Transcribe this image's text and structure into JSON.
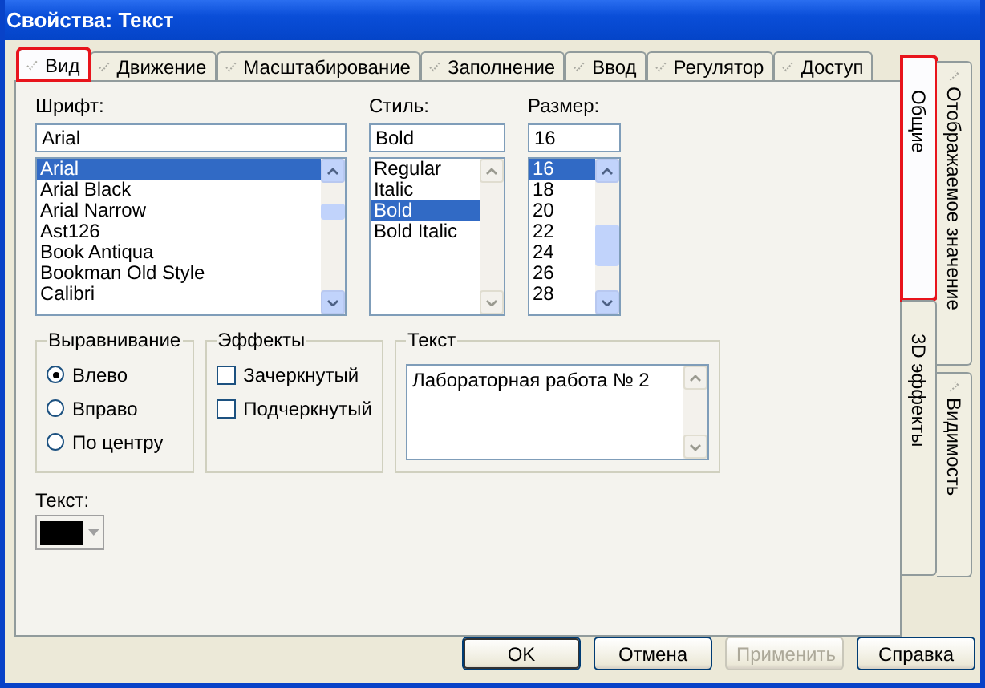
{
  "window": {
    "title": "Свойства: Текст"
  },
  "tabs": [
    {
      "label": "Вид",
      "selected": true,
      "marked": true
    },
    {
      "label": "Движение",
      "selected": false,
      "marked": false
    },
    {
      "label": "Масштабирование",
      "selected": false,
      "marked": false
    },
    {
      "label": "Заполнение",
      "selected": false,
      "marked": false
    },
    {
      "label": "Ввод",
      "selected": false,
      "marked": false
    },
    {
      "label": "Регулятор",
      "selected": false,
      "marked": false
    },
    {
      "label": "Доступ",
      "selected": false,
      "marked": false
    }
  ],
  "font": {
    "label": "Шрифт:",
    "value": "Arial",
    "items": [
      {
        "text": "Arial",
        "selected": true
      },
      {
        "text": "Arial Black",
        "selected": false
      },
      {
        "text": "Arial Narrow",
        "selected": false
      },
      {
        "text": "Ast126",
        "selected": false
      },
      {
        "text": "Book Antiqua",
        "selected": false
      },
      {
        "text": "Bookman Old Style",
        "selected": false
      },
      {
        "text": "Calibri",
        "selected": false
      }
    ]
  },
  "style": {
    "label": "Стиль:",
    "value": "Bold",
    "items": [
      {
        "text": "Regular",
        "selected": false
      },
      {
        "text": "Italic",
        "selected": false
      },
      {
        "text": "Bold",
        "selected": true
      },
      {
        "text": "Bold Italic",
        "selected": false
      }
    ]
  },
  "size": {
    "label": "Размер:",
    "value": "16",
    "items": [
      {
        "text": "16",
        "selected": true
      },
      {
        "text": "18",
        "selected": false
      },
      {
        "text": "20",
        "selected": false
      },
      {
        "text": "22",
        "selected": false
      },
      {
        "text": "24",
        "selected": false
      },
      {
        "text": "26",
        "selected": false
      },
      {
        "text": "28",
        "selected": false
      }
    ]
  },
  "alignment": {
    "title": "Выравнивание",
    "options": [
      {
        "label": "Влево",
        "selected": true
      },
      {
        "label": "Вправо",
        "selected": false
      },
      {
        "label": "По центру",
        "selected": false
      }
    ]
  },
  "effects": {
    "title": "Эффекты",
    "options": [
      {
        "label": "Зачеркнутый",
        "checked": false
      },
      {
        "label": "Подчеркнутый",
        "checked": false
      }
    ]
  },
  "text_group": {
    "title": "Текст",
    "value": "Лабораторная работа № 2"
  },
  "text_color": {
    "label": "Текст:",
    "color": "#000000"
  },
  "side_tabs": [
    [
      {
        "label": "Общие",
        "selected": true,
        "marked": true,
        "checkmark": false
      },
      {
        "label": "3D эффекты",
        "selected": false,
        "marked": false,
        "checkmark": false
      }
    ],
    [
      {
        "label": "Отображаемое значение",
        "selected": false,
        "marked": false,
        "checkmark": true
      },
      {
        "label": "Видимость",
        "selected": false,
        "marked": false,
        "checkmark": true
      }
    ]
  ],
  "buttons": [
    {
      "label": "OK",
      "disabled": false,
      "default": true
    },
    {
      "label": "Отмена",
      "disabled": false,
      "default": false
    },
    {
      "label": "Применить",
      "disabled": true,
      "default": false
    },
    {
      "label": "Справка",
      "disabled": false,
      "default": false
    }
  ]
}
